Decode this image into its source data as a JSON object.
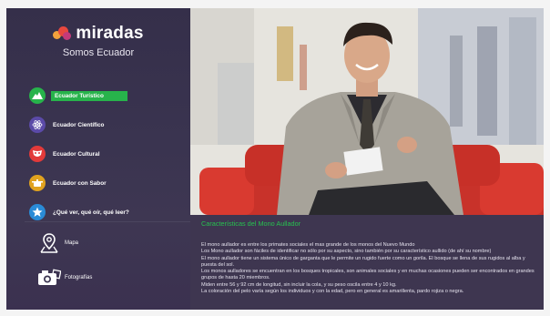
{
  "brand": {
    "name": "miradas",
    "tagline": "Somos Ecuador"
  },
  "menu": [
    {
      "label": "Ecuador Turístico",
      "icon": "mountain-icon",
      "color": "#27b34b",
      "active": true
    },
    {
      "label": "Ecuador Científico",
      "icon": "atom-icon",
      "color": "#5b4aa8",
      "active": false
    },
    {
      "label": "Ecuador Cultural",
      "icon": "mask-icon",
      "color": "#e23a3a",
      "active": false
    },
    {
      "label": "Ecuador con Sabor",
      "icon": "cooking-pot-icon",
      "color": "#e0a21f",
      "active": false
    },
    {
      "label": "¿Qué ver, qué oír, qué leer?",
      "icon": "star-icon",
      "color": "#2a8bd6",
      "active": false
    }
  ],
  "bottom_nav": [
    {
      "label": "Mapa",
      "icon": "map-pin-icon"
    },
    {
      "label": "Fotografías",
      "icon": "camera-icon"
    }
  ],
  "article": {
    "title": "Características del Mono Aullador",
    "paragraphs": [
      "El mono aullador es entre los primates sociales el mas grande de los monos del Nuevo Mundo",
      "Los Mono aullador son fáciles de identificar no sólo por su aspecto, sino también por su característico aullido (de ahí su nombre)",
      "El mono aullador tiene un sistema único de garganta que le permite un rugido fuerte como un gorila.  El bosque se llena de sus rugidos al alba y puesta del sol.",
      "Los monos aulladores se encuentran en los bosques tropicales, son animales sociales y en muchas ocasiones pueden ser encontrados en grandes grupos de hasta 20 miembros.",
      "Miden entre 56 y 92 cm de longitud, sin incluir la cola, y su peso oscila entre 4 y 10 kg.",
      "La coloración del pelo varía según los individuos y con la edad, pero en general es amarillenta, pardo rojiza o negra."
    ]
  },
  "colors": {
    "background": "#3a3450",
    "accent_green": "#27b34b",
    "title_green": "#27c24f"
  }
}
